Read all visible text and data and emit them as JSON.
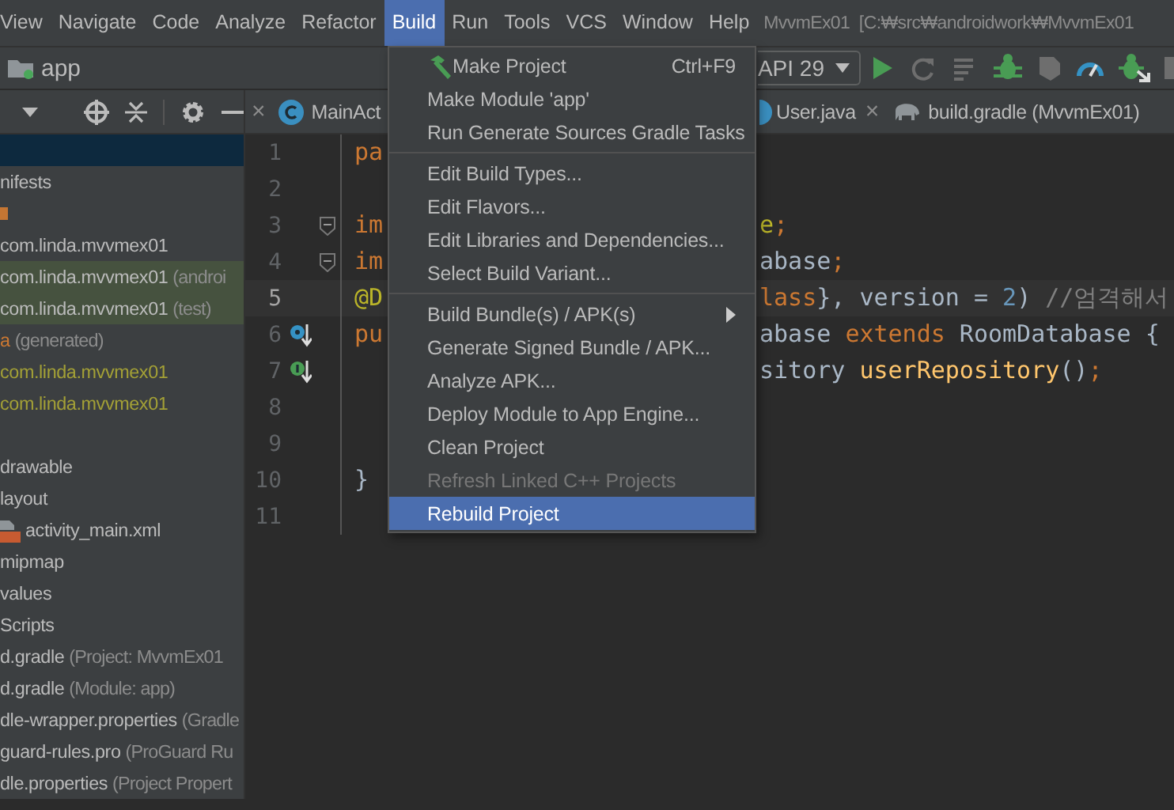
{
  "menubar": {
    "items": [
      {
        "label": "View",
        "selected": false
      },
      {
        "label": "Navigate",
        "selected": false
      },
      {
        "label": "Code",
        "selected": false
      },
      {
        "label": "Analyze",
        "selected": false
      },
      {
        "label": "Refactor",
        "selected": false
      },
      {
        "label": "Build",
        "selected": true
      },
      {
        "label": "Run",
        "selected": false
      },
      {
        "label": "Tools",
        "selected": false
      },
      {
        "label": "VCS",
        "selected": false
      },
      {
        "label": "Window",
        "selected": false
      },
      {
        "label": "Help",
        "selected": false
      }
    ],
    "title": "MvvmEx01  [C:₩src₩androidwork₩MvvmEx01"
  },
  "toolbar": {
    "module": "app",
    "device": "API 29"
  },
  "project_panel": {
    "rows": [
      {
        "kind": "blank",
        "selected": true,
        "highlighted": false
      },
      {
        "kind": "text",
        "label": "nifests",
        "color": "#bbbbbb",
        "selected": false,
        "highlighted": false
      },
      {
        "kind": "stub",
        "selected": false,
        "highlighted": false
      },
      {
        "kind": "text",
        "label": "com.linda.mvvmex01",
        "color": "#bbbbbb",
        "selected": false,
        "highlighted": false
      },
      {
        "kind": "text",
        "label": "com.linda.mvvmex01",
        "note": "(androi",
        "color": "#bbbbbb",
        "selected": false,
        "highlighted": true
      },
      {
        "kind": "text",
        "label": "com.linda.mvvmex01",
        "note": "(test)",
        "color": "#bbbbbb",
        "selected": false,
        "highlighted": true
      },
      {
        "kind": "text",
        "label": "a",
        "note": "(generated)",
        "color": "#cc7832",
        "selected": false,
        "highlighted": false
      },
      {
        "kind": "text",
        "label": "com.linda.mvvmex01",
        "color": "#a3a036",
        "selected": false,
        "highlighted": false
      },
      {
        "kind": "text",
        "label": "com.linda.mvvmex01",
        "color": "#a3a036",
        "selected": false,
        "highlighted": false
      },
      {
        "kind": "blank",
        "selected": false,
        "highlighted": false
      },
      {
        "kind": "text",
        "label": "drawable",
        "color": "#bbbbbb",
        "selected": false,
        "highlighted": false
      },
      {
        "kind": "text",
        "label": "layout",
        "color": "#bbbbbb",
        "selected": false,
        "highlighted": false,
        "children": [
          {
            "kind": "xml",
            "label": "activity_main.xml",
            "color": "#bbbbbb",
            "selected": false,
            "highlighted": false
          }
        ]
      },
      {
        "kind": "text",
        "label": "mipmap",
        "color": "#bbbbbb",
        "selected": false,
        "highlighted": false
      },
      {
        "kind": "text",
        "label": "values",
        "color": "#bbbbbb",
        "selected": false,
        "highlighted": false
      },
      {
        "kind": "text",
        "label": "Scripts",
        "color": "#bbbbbb",
        "selected": false,
        "highlighted": false
      },
      {
        "kind": "text",
        "label": "d.gradle",
        "note": "(Project: MvvmEx01",
        "color": "#bbbbbb",
        "selected": false,
        "highlighted": false
      },
      {
        "kind": "text",
        "label": "d.gradle",
        "note": "(Module: app)",
        "color": "#bbbbbb",
        "selected": false,
        "highlighted": false
      },
      {
        "kind": "text",
        "label": "dle-wrapper.properties",
        "note": "(Gradle",
        "color": "#bbbbbb",
        "selected": false,
        "highlighted": false
      },
      {
        "kind": "text",
        "label": "guard-rules.pro",
        "note": "(ProGuard Ru",
        "color": "#bbbbbb",
        "selected": false,
        "highlighted": false
      },
      {
        "kind": "text",
        "label": "dle.properties",
        "note": "(Project Propert",
        "color": "#bbbbbb",
        "selected": false,
        "highlighted": false
      }
    ]
  },
  "editor": {
    "tabs": [
      {
        "kind": "close",
        "text": "×"
      },
      {
        "kind": "class",
        "label": "MainAct"
      },
      {
        "kind": "class-cut",
        "label": "User.java"
      },
      {
        "kind": "close",
        "text": "×"
      },
      {
        "kind": "gradle",
        "label": "build.gradle (MvvmEx01)"
      }
    ],
    "lines": [
      {
        "number": "1",
        "current": false,
        "fold": false,
        "kind": "plain",
        "left": [
          {
            "text": "pa",
            "kind": "keyword"
          }
        ]
      },
      {
        "number": "2",
        "current": false,
        "fold": false,
        "kind": "plain"
      },
      {
        "number": "3",
        "current": false,
        "fold": true,
        "kind": "plain",
        "left": [
          {
            "text": "im",
            "kind": "keyword"
          }
        ],
        "right": [
          {
            "text": "e",
            "kind": "annotation"
          },
          {
            "text": ";",
            "kind": "keyword"
          }
        ]
      },
      {
        "number": "4",
        "current": false,
        "fold": true,
        "kind": "plain",
        "left": [
          {
            "text": "im",
            "kind": "keyword"
          }
        ],
        "right": [
          {
            "text": "abase",
            "kind": "plain"
          },
          {
            "text": ";",
            "kind": "keyword"
          }
        ]
      },
      {
        "number": "5",
        "current": true,
        "fold": false,
        "kind": "plain",
        "left": [
          {
            "text": "@D",
            "kind": "annotation"
          }
        ],
        "right": [
          {
            "text": "lass",
            "kind": "keyword"
          },
          {
            "text": "}, version = ",
            "kind": "plain"
          },
          {
            "text": "2",
            "kind": "number"
          },
          {
            "text": ") ",
            "kind": "plain"
          },
          {
            "text": "//엄격해서",
            "kind": "comment"
          }
        ]
      },
      {
        "number": "6",
        "current": false,
        "fold": false,
        "kind": "overridden",
        "left": [
          {
            "text": "pu",
            "kind": "keyword"
          }
        ],
        "right": [
          {
            "text": "abase ",
            "kind": "plain"
          },
          {
            "text": "extends",
            "kind": "keyword"
          },
          {
            "text": " RoomDatabase {",
            "kind": "plain"
          }
        ]
      },
      {
        "number": "7",
        "current": false,
        "fold": false,
        "kind": "implemented",
        "right": [
          {
            "text": "sitory ",
            "kind": "plain"
          },
          {
            "text": "userRepository",
            "kind": "method"
          },
          {
            "text": "()",
            "kind": "plain"
          },
          {
            "text": ";",
            "kind": "keyword"
          }
        ]
      },
      {
        "number": "8",
        "current": false,
        "fold": false,
        "kind": "plain"
      },
      {
        "number": "9",
        "current": false,
        "fold": false,
        "kind": "plain"
      },
      {
        "number": "10",
        "current": false,
        "fold": false,
        "kind": "plain",
        "left": [
          {
            "text": "}",
            "kind": "plain"
          }
        ]
      },
      {
        "number": "11",
        "current": false,
        "fold": false,
        "kind": "plain"
      }
    ]
  },
  "build_menu": {
    "items": [
      {
        "kind": "tool",
        "label": "Make Project",
        "shortcut": "Ctrl+F9",
        "submenu": false,
        "disabled": false,
        "selected": false
      },
      {
        "kind": "item",
        "label": "Make Module 'app'",
        "submenu": false,
        "disabled": false,
        "selected": false
      },
      {
        "kind": "item",
        "label": "Run Generate Sources Gradle Tasks",
        "submenu": false,
        "disabled": false,
        "selected": false
      },
      {
        "kind": "separator"
      },
      {
        "kind": "item",
        "label": "Edit Build Types...",
        "submenu": false,
        "disabled": false,
        "selected": false
      },
      {
        "kind": "item",
        "label": "Edit Flavors...",
        "submenu": false,
        "disabled": false,
        "selected": false
      },
      {
        "kind": "item",
        "label": "Edit Libraries and Dependencies...",
        "submenu": false,
        "disabled": false,
        "selected": false
      },
      {
        "kind": "item",
        "label": "Select Build Variant...",
        "submenu": false,
        "disabled": false,
        "selected": false
      },
      {
        "kind": "separator"
      },
      {
        "kind": "item",
        "label": "Build Bundle(s) / APK(s)",
        "submenu": true,
        "disabled": false,
        "selected": false
      },
      {
        "kind": "item",
        "label": "Generate Signed Bundle / APK...",
        "submenu": false,
        "disabled": false,
        "selected": false
      },
      {
        "kind": "item",
        "label": "Analyze APK...",
        "submenu": false,
        "disabled": false,
        "selected": false
      },
      {
        "kind": "item",
        "label": "Deploy Module to App Engine...",
        "submenu": false,
        "disabled": false,
        "selected": false
      },
      {
        "kind": "item",
        "label": "Clean Project",
        "submenu": false,
        "disabled": false,
        "selected": false
      },
      {
        "kind": "item",
        "label": "Refresh Linked C++ Projects",
        "submenu": false,
        "disabled": true,
        "selected": false
      },
      {
        "kind": "item",
        "label": "Rebuild Project",
        "submenu": false,
        "disabled": false,
        "selected": true
      }
    ]
  }
}
